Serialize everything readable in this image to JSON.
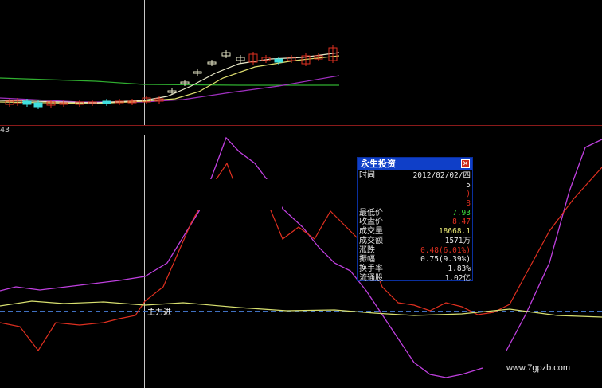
{
  "axis_label": "43",
  "indicator_label": "主力进",
  "watermark": "www.7gpzb.com",
  "colors": {
    "grid_red": "#8a1a1a",
    "crosshair": "#c8c8c8",
    "magenta": "#c040e0",
    "red": "#e03020",
    "yellow_green": "#d8e070",
    "white_ma": "#e8e8c8",
    "yellow_ma": "#e0e070",
    "green_ma": "#30b030",
    "purple_ma": "#a030c0",
    "up_red": "#e03020",
    "down_cyan": "#40e0e0",
    "dashed_blue": "#4070c0"
  },
  "popup": {
    "title": "永生投资",
    "close_icon": "close-icon",
    "rows": [
      {
        "key": "时间",
        "value": "2012/02/02/四",
        "color": "#e6e6e6"
      },
      {
        "key": "",
        "value": "5",
        "color": "#e6e6e6"
      },
      {
        "key": "",
        "value": ")",
        "color": "#e03020"
      },
      {
        "key": "",
        "value": "8",
        "color": "#e03020"
      },
      {
        "key": "最低价",
        "value": "7.93",
        "color": "#40e040"
      },
      {
        "key": "收盘价",
        "value": "8.47",
        "color": "#e03020"
      },
      {
        "key": "成交量",
        "value": "18668.1",
        "color": "#e0e070"
      },
      {
        "key": "成交额",
        "value": "1571万",
        "color": "#e6e6e6"
      },
      {
        "key": "涨跌",
        "value": "0.48(6.01%)",
        "color": "#e03020"
      },
      {
        "key": "振幅",
        "value": "0.75(9.39%)",
        "color": "#e6e6e6"
      },
      {
        "key": "换手率",
        "value": "1.83%",
        "color": "#e6e6e6"
      },
      {
        "key": "流通股",
        "value": "1.02亿",
        "color": "#e6e6e6"
      }
    ]
  }
}
